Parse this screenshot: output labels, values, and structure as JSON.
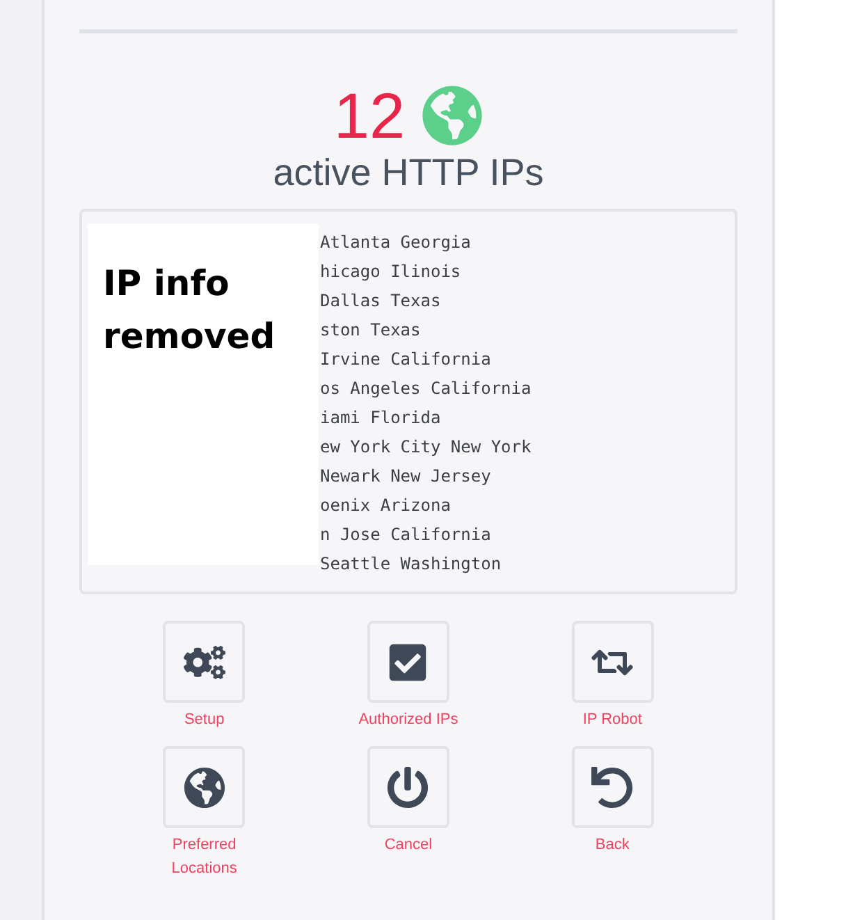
{
  "summary": {
    "count": "12",
    "label": "active HTTP IPs"
  },
  "ip_list": {
    "lines": [
      "Atlanta Georgia",
      "hicago Ilinois",
      "Dallas Texas",
      "ston Texas",
      "Irvine California",
      "os Angeles California",
      "iami Florida",
      "ew York City New York",
      "Newark New Jersey",
      "oenix Arizona",
      "n Jose California",
      "Seattle Washington"
    ],
    "redaction_note": "IP info removed"
  },
  "actions": [
    {
      "kind": "setup",
      "label": "Setup"
    },
    {
      "kind": "authorized",
      "label": "Authorized IPs"
    },
    {
      "kind": "robot",
      "label": "IP Robot"
    },
    {
      "kind": "locations",
      "label": "Preferred Locations"
    },
    {
      "kind": "cancel",
      "label": "Cancel"
    },
    {
      "kind": "back",
      "label": "Back"
    }
  ]
}
